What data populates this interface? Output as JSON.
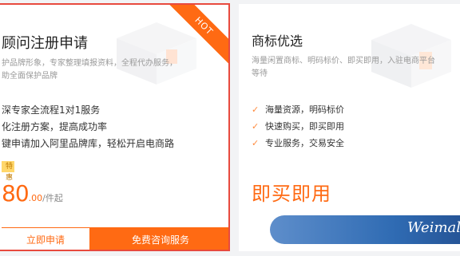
{
  "left_card": {
    "title": "顾问注册申请",
    "hot_label": "HOT",
    "desc_line1": "护品牌形象，专家整理填报资料，全程代办服务，",
    "desc_line2": "助全面保护品牌",
    "features": [
      "深专家全流程1对1服务",
      "化注册方案，提高成功率",
      "键申请加入阿里品牌库，轻松开启电商路"
    ],
    "promo_label": "特惠",
    "price_main": "80",
    "price_decimal": ".00",
    "price_unit": "/件起",
    "apply_button": "立即申请",
    "consult_button": "免费咨询服务"
  },
  "right_card": {
    "title": "商标优选",
    "desc_line1": "海量闲置商标、明码标价、即买即用，入驻电商平台",
    "desc_line2": "等待",
    "features": [
      "海量资源，明码标价",
      "快速购买，即买即用",
      "专业服务，交易安全"
    ],
    "headline": "即买即用"
  },
  "watermark": {
    "text": "Weimal"
  },
  "colors": {
    "accent": "#ff6a13",
    "border_active": "#e84a3e",
    "check": "#ff8a3d"
  },
  "icons": {
    "check": "check-icon"
  }
}
